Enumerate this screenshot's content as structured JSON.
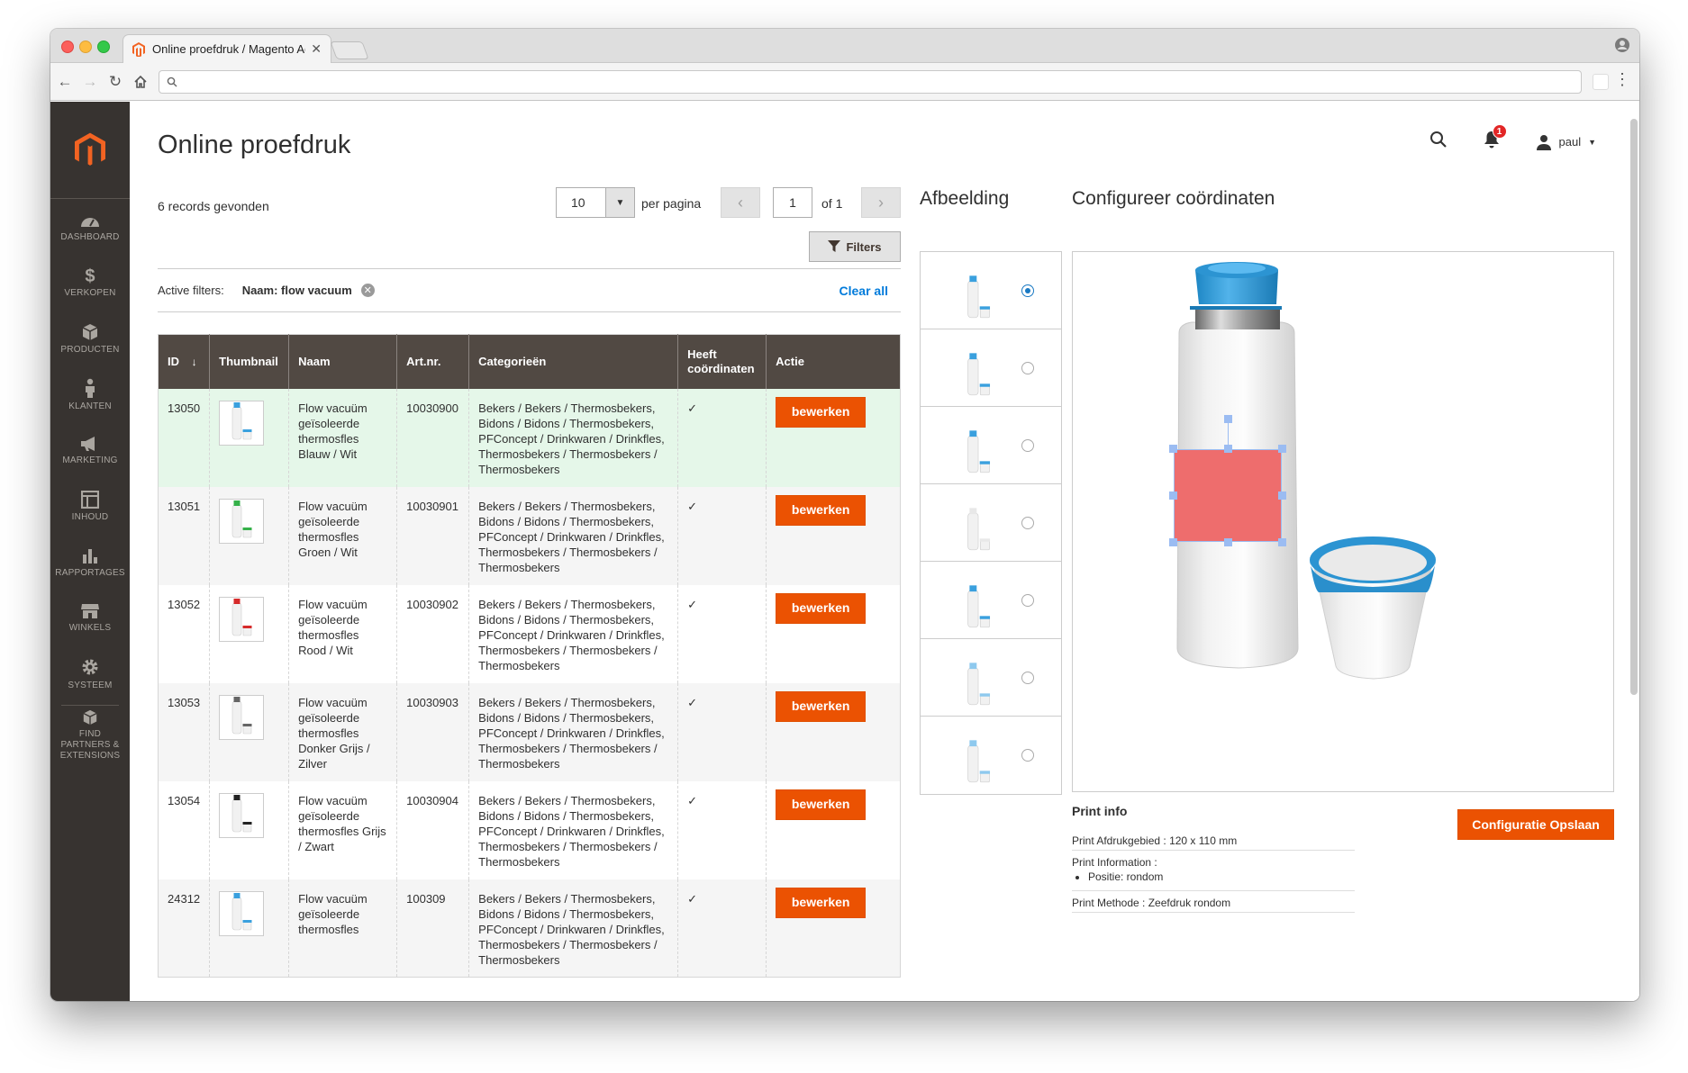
{
  "browser": {
    "tab_title": "Online proefdruk / Magento Ad",
    "url": ""
  },
  "sidebar": {
    "items": [
      {
        "label": "Dashboard",
        "icon": "dashboard-icon"
      },
      {
        "label": "Verkopen",
        "icon": "dollar-icon"
      },
      {
        "label": "Producten",
        "icon": "box-icon"
      },
      {
        "label": "Klanten",
        "icon": "person-icon"
      },
      {
        "label": "Marketing",
        "icon": "megaphone-icon"
      },
      {
        "label": "Inhoud",
        "icon": "layout-icon"
      },
      {
        "label": "Rapportages",
        "icon": "bar-chart-icon"
      },
      {
        "label": "Winkels",
        "icon": "store-icon"
      },
      {
        "label": "Systeem",
        "icon": "gear-icon"
      }
    ],
    "find_partners": "Find Partners & Extensions"
  },
  "header": {
    "title": "Online proefdruk",
    "notifications_count": "1",
    "user": "paul"
  },
  "grid": {
    "records": "6 records gevonden",
    "per_page_value": "10",
    "per_page_label": "per pagina",
    "page_value": "1",
    "page_of": "of 1",
    "filters_label": "Filters",
    "active_filters_label": "Active filters:",
    "active_filter": "Naam: flow vacuum",
    "clear_all": "Clear all",
    "columns": [
      "ID",
      "Thumbnail",
      "Naam",
      "Art.nr.",
      "Categorieën",
      "Heeft coördinaten",
      "Actie"
    ],
    "edit_label": "bewerken",
    "rows": [
      {
        "id": "13050",
        "naam": "Flow vacuüm geïsoleerde thermosfles Blauw / Wit",
        "artnr": "10030900",
        "cat": "Bekers / Bekers / Thermosbekers, Bidons / Bidons / Thermosbekers, PFConcept / Drinkwaren / Drinkfles, Thermosbekers / Thermosbekers / Thermosbekers",
        "coord": "✓",
        "color": "#3aa0de"
      },
      {
        "id": "13051",
        "naam": "Flow vacuüm geïsoleerde thermosfles Groen / Wit",
        "artnr": "10030901",
        "cat": "Bekers / Bekers / Thermosbekers, Bidons / Bidons / Thermosbekers, PFConcept / Drinkwaren / Drinkfles, Thermosbekers / Thermosbekers / Thermosbekers",
        "coord": "✓",
        "color": "#35b14a"
      },
      {
        "id": "13052",
        "naam": "Flow vacuüm geïsoleerde thermosfles Rood / Wit",
        "artnr": "10030902",
        "cat": "Bekers / Bekers / Thermosbekers, Bidons / Bidons / Thermosbekers, PFConcept / Drinkwaren / Drinkfles, Thermosbekers / Thermosbekers / Thermosbekers",
        "coord": "✓",
        "color": "#d62a2a"
      },
      {
        "id": "13053",
        "naam": "Flow vacuüm geïsoleerde thermosfles Donker Grijs / Zilver",
        "artnr": "10030903",
        "cat": "Bekers / Bekers / Thermosbekers, Bidons / Bidons / Thermosbekers, PFConcept / Drinkwaren / Drinkfles, Thermosbekers / Thermosbekers / Thermosbekers",
        "coord": "✓",
        "color": "#666666"
      },
      {
        "id": "13054",
        "naam": "Flow vacuüm geïsoleerde thermosfles Grijs / Zwart",
        "artnr": "10030904",
        "cat": "Bekers / Bekers / Thermosbekers, Bidons / Bidons / Thermosbekers, PFConcept / Drinkwaren / Drinkfles, Thermosbekers / Thermosbekers / Thermosbekers",
        "coord": "✓",
        "color": "#222222"
      },
      {
        "id": "24312",
        "naam": "Flow vacuüm geïsoleerde thermosfles",
        "artnr": "100309",
        "cat": "Bekers / Bekers / Thermosbekers, Bidons / Bidons / Thermosbekers, PFConcept / Drinkwaren / Drinkfles, Thermosbekers / Thermosbekers / Thermosbekers",
        "coord": "✓",
        "color": "#3aa0de"
      }
    ]
  },
  "images": {
    "title": "Afbeelding",
    "selected_index": 0
  },
  "config": {
    "title": "Configureer coördinaten",
    "print_info_title": "Print info",
    "print_area": "Print Afdrukgebied : 120 x 110 mm",
    "print_information": "Print Information :",
    "position": "Positie: rondom",
    "print_method": "Print Methode : Zeefdruk rondom",
    "save_label": "Configuratie Opslaan"
  },
  "colors": {
    "accent": "#eb5202",
    "sidebar": "#373330",
    "table_header": "#514943",
    "link": "#007bdb",
    "selection_fill": "#ee6d6d",
    "handle": "#9bbcf2"
  }
}
